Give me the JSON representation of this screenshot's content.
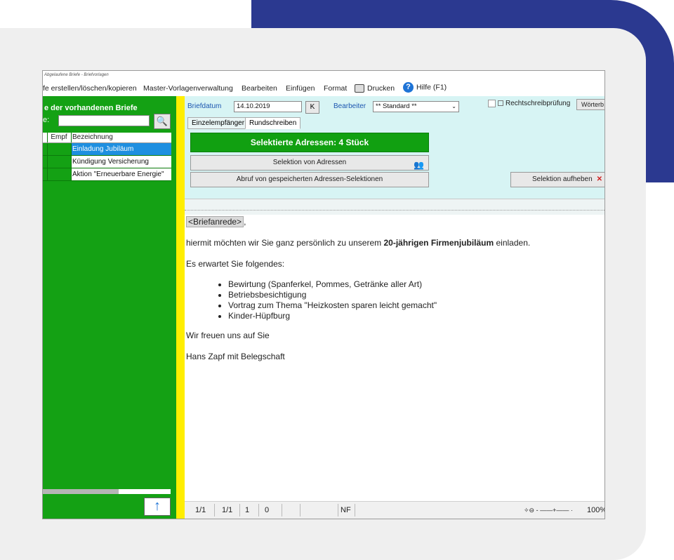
{
  "window": {
    "title": "Abgelaufene Briefe - Briefvorlagen"
  },
  "menu": {
    "items": [
      "Briefe erstellen/löschen/kopieren",
      "Master-Vorlagenverwaltung",
      "Bearbeiten",
      "Einfügen",
      "Format",
      "Drucken",
      "Hilfe (F1)"
    ],
    "shown": [
      "fe erstellen/löschen/kopieren",
      "Master-Vorlagenverwaltung",
      "Bearbeiten",
      "Einfügen",
      "Format",
      "Drucken",
      "Hilfe (F1)"
    ]
  },
  "left_panel": {
    "title": "e der vorhandenen Briefe",
    "filter_label": "e:",
    "filter_value": "",
    "columns": [
      "Empf",
      "Bezeichnung"
    ],
    "rows": [
      {
        "label": "Einladung Jubiläum",
        "selected": true
      },
      {
        "label": "Kündigung Versicherung",
        "selected": false
      },
      {
        "label": "Aktion \"Erneuerbare Energie\"",
        "selected": false
      }
    ],
    "up_arrow": "↑",
    "down_arrow": "↓"
  },
  "header": {
    "date_label": "Briefdatum",
    "date_value": "14.10.2019",
    "k_button": "K",
    "editor_label": "Bearbeiter",
    "editor_value": "** Standard **",
    "spellcheck_label": "Rechtschreibprüfung",
    "word_button": "Wörterb"
  },
  "tabs": [
    {
      "label": "Einzelempfänger",
      "active": false
    },
    {
      "label": "Rundschreiben",
      "active": true
    }
  ],
  "actions": {
    "selected_banner": "Selektierte Adressen:  4 Stück",
    "select_addresses": "Selektion von Adressen",
    "load_saved": "Abruf von gespeicherten Adressen-Selektionen",
    "clear_selection": "Selektion aufheben"
  },
  "document": {
    "salutation": "<Briefanrede>",
    "paragraph1_pre": "hiermit möchten wir Sie ganz persönlich zu unserem ",
    "paragraph1_bold": "20-jährigen Firmenjubiläum",
    "paragraph1_post": " einladen.",
    "paragraph2": "Es erwartet Sie folgendes:",
    "bullets": [
      "Bewirtung (Spanferkel, Pommes, Getränke aller Art)",
      "Betriebsbesichtigung",
      "Vortrag zum Thema \"Heizkosten sparen leicht gemacht\"",
      "Kinder-Hüpfburg"
    ],
    "closing": "Wir freuen uns auf Sie",
    "signature": "Hans Zapf mit Belegschaft"
  },
  "statusbar": {
    "page": "1/1",
    "section": "1/1",
    "line": "1",
    "col": "0",
    "mode": "NF",
    "zoom": "100%"
  },
  "colors": {
    "accent_blue": "#2b3990",
    "panel_green": "#14a114",
    "strip_yellow": "#ffee00",
    "selection_blue": "#1e8fe0"
  }
}
